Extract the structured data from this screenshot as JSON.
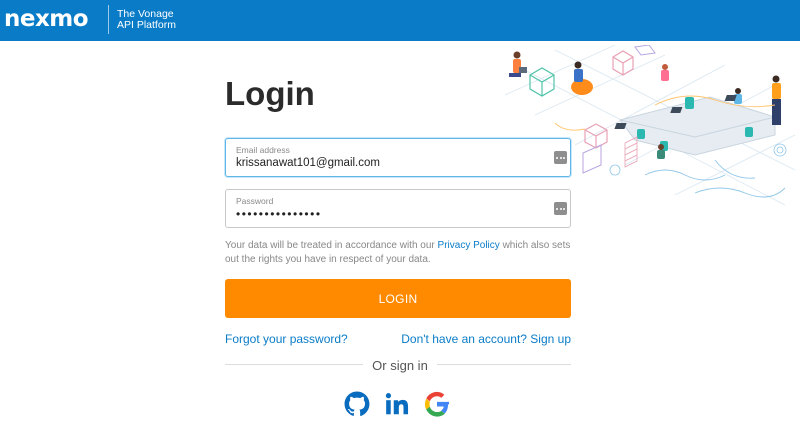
{
  "header": {
    "logo_text": "nexmo",
    "tagline_line1": "The Vonage",
    "tagline_line2": "API Platform",
    "background_color": "#0a7cc7"
  },
  "login": {
    "title": "Login",
    "email": {
      "label": "Email address",
      "value": "krissanawat101@gmail.com",
      "icon": "more-options-icon"
    },
    "password": {
      "label": "Password",
      "value": "•••••••••••••••",
      "icon": "more-options-icon"
    },
    "policy": {
      "before": "Your data will be treated in accordance with our ",
      "link": "Privacy Policy",
      "after": " which also sets out the rights you have in respect of your data."
    },
    "submit_label": "LOGIN",
    "submit_color": "#ff8a00",
    "forgot_password": "Forgot your password?",
    "signup": "Don't have an account? Sign up",
    "or_sign_in": "Or sign in",
    "social": [
      {
        "name": "github",
        "icon": "github-icon"
      },
      {
        "name": "linkedin",
        "icon": "linkedin-icon"
      },
      {
        "name": "google",
        "icon": "google-icon"
      }
    ]
  }
}
